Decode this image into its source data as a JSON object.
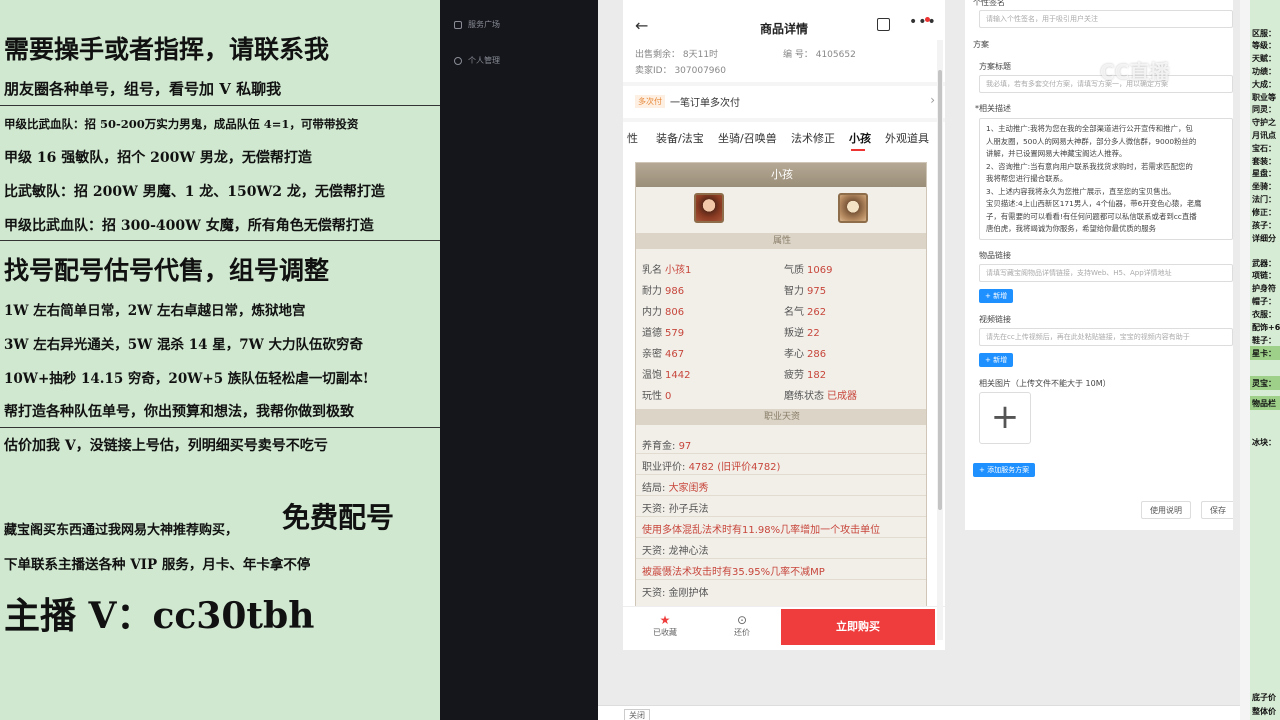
{
  "left_panel": {
    "lines": [
      "需要操手或者指挥，请联系我",
      "朋友圈各种单号，组号，看号加 V 私聊我",
      "甲级比武血队：招 50-200万实力男鬼，成品队伍 4=1，可带带投资",
      "甲级 16 强敏队，招个 200W 男龙，无偿帮打造",
      "比武敏队：招 200W 男魔、1 龙、150W2 龙，无偿帮打造",
      "甲级比武血队：招 300-400W 女魔，所有角色无偿帮打造",
      "找号配号估号代售，组号调整",
      "1W 左右简单日常，2W 左右卓越日常，炼狱地宫",
      "3W 左右异光通关，5W 混杀 14 星，7W 大力队伍砍穷奇",
      "10W+抽秒 14.15 穷奇，20W+5 族队伍轻松虐一切副本!",
      "帮打造各种队伍单号，你出预算和想法，我帮你做到极致",
      "估价加我 V，没链接上号估，列明细买号卖号不吃亏",
      "藏宝阁买东西通过我网易大神推荐购买，",
      "免费配号",
      "下单联系主播送各种 VIP 服务，月卡、年卡拿不停",
      "主播 V：cc30tbh"
    ]
  },
  "dark_sidebar": {
    "items": [
      "服务广场",
      "个人管理"
    ]
  },
  "phone": {
    "title": "商品详情",
    "meta": {
      "sale_remaining": "出售剩余：  8天11时",
      "number": "编 号：  4105652",
      "seller_id": "卖家ID：  307007960"
    },
    "order_tag": "多次付",
    "order_text": "一笔订单多次付",
    "tabs": [
      "性",
      "装备/法宝",
      "坐骑/召唤兽",
      "法术修正",
      "小孩",
      "外观道具"
    ],
    "active_tab": "小孩",
    "card": {
      "header": "小孩",
      "section_attr": "属性",
      "attrs_left": [
        {
          "k": "乳名",
          "v": "小孩1"
        },
        {
          "k": "耐力",
          "v": "986"
        },
        {
          "k": "内力",
          "v": "806"
        },
        {
          "k": "道德",
          "v": "579"
        },
        {
          "k": "亲密",
          "v": "467"
        },
        {
          "k": "温饱",
          "v": "1442"
        },
        {
          "k": "玩性",
          "v": "0"
        }
      ],
      "attrs_right": [
        {
          "k": "气质",
          "v": "1069"
        },
        {
          "k": "智力",
          "v": "975"
        },
        {
          "k": "名气",
          "v": "262"
        },
        {
          "k": "叛逆",
          "v": "22"
        },
        {
          "k": "孝心",
          "v": "286"
        },
        {
          "k": "疲劳",
          "v": "182"
        },
        {
          "k": "磨练状态",
          "v": "已成器"
        }
      ],
      "section_prof": "职业天资",
      "prof_rows": [
        {
          "k": "养育金:",
          "v": "97"
        },
        {
          "k": "职业评价:",
          "v": "4782 (旧评价4782)"
        },
        {
          "k": "结局:",
          "v": "大家闺秀"
        },
        {
          "k": "天资:",
          "v": "孙子兵法"
        }
      ],
      "skill1_desc": "使用多体混乱法术时有11.98%几率增加一个攻击单位",
      "skill2_name": "天资: 龙神心法",
      "skill2_desc": "被震慑法术攻击时有35.95%几率不减MP",
      "skill3_name": "天资: 金刚护体"
    },
    "bottom": {
      "fav": "已收藏",
      "bargain": "还价",
      "buy": "立即购买"
    }
  },
  "close_label": "关闭",
  "form": {
    "sign_label": "个性签名",
    "sign_placeholder": "请输入个性签名，用于吸引用户关注",
    "plan_label": "方案",
    "plan_title_label": "方案标题",
    "plan_title_placeholder": "我必填，若有多套交付方案，请填写方案一，用以确定方案",
    "desc_label": "*相关描述",
    "desc_lines": [
      "1、主动推广:我将为您在我的全部渠道进行公开宣传和推广，包",
      "人朋友圈，500人的网易大神群，部分多人微信群，9000粉丝的",
      "讲解，并已设置网易大神藏宝阁达人推荐。",
      "2、咨询推广:当有意向用户联系我找货求购时，若需求匹配您的",
      "我将帮您进行撮合联系。",
      "3、上述内容我将永久为您推广展示，直至您的宝贝售出。",
      "宝贝描述:4上山西新区171男人，4个仙器，带6开变色心猿，老鹰",
      "子，有需要的可以看看!有任何问题都可以私信联系或者到cc直播",
      "唐伯虎，我将竭诚为你服务，希望给你最优质的服务"
    ],
    "item_link_label": "物品链接",
    "item_link_placeholder": "请填写藏宝阁物品详情链接，支持Web、H5、App详情地址",
    "add_label": "+ 新增",
    "video_link_label": "视频链接",
    "video_link_placeholder": "请先在cc上传视频后，再在此处粘贴链接，宝宝的视频内容有助于",
    "images_label": "相关图片（上传文件不能大于 10M）",
    "upload_icon": "+",
    "add_plan": "+ 添加服务方案",
    "usage_btn": "使用说明",
    "save_btn": "保存"
  },
  "watermark": "CC直播",
  "far_right": {
    "keys": [
      "区服：",
      "等级：",
      "天赋：",
      "功绩：",
      "大成：",
      "职业等",
      "同灵：",
      "守护之",
      "月讯点",
      "宝石：",
      "套装：",
      "星盘：",
      "坐骑：",
      "法门：",
      "修正：",
      "孩子：",
      "详细分",
      "武器：",
      "项链：",
      "护身符",
      "帽子：",
      "衣服：",
      "配饰+6",
      "鞋子：",
      "星卡：",
      "灵宝：",
      "物品栏",
      "冰块：",
      "底子价",
      "整体价"
    ],
    "highlighted": [
      "星卡：",
      "灵宝：",
      "物品栏"
    ]
  }
}
